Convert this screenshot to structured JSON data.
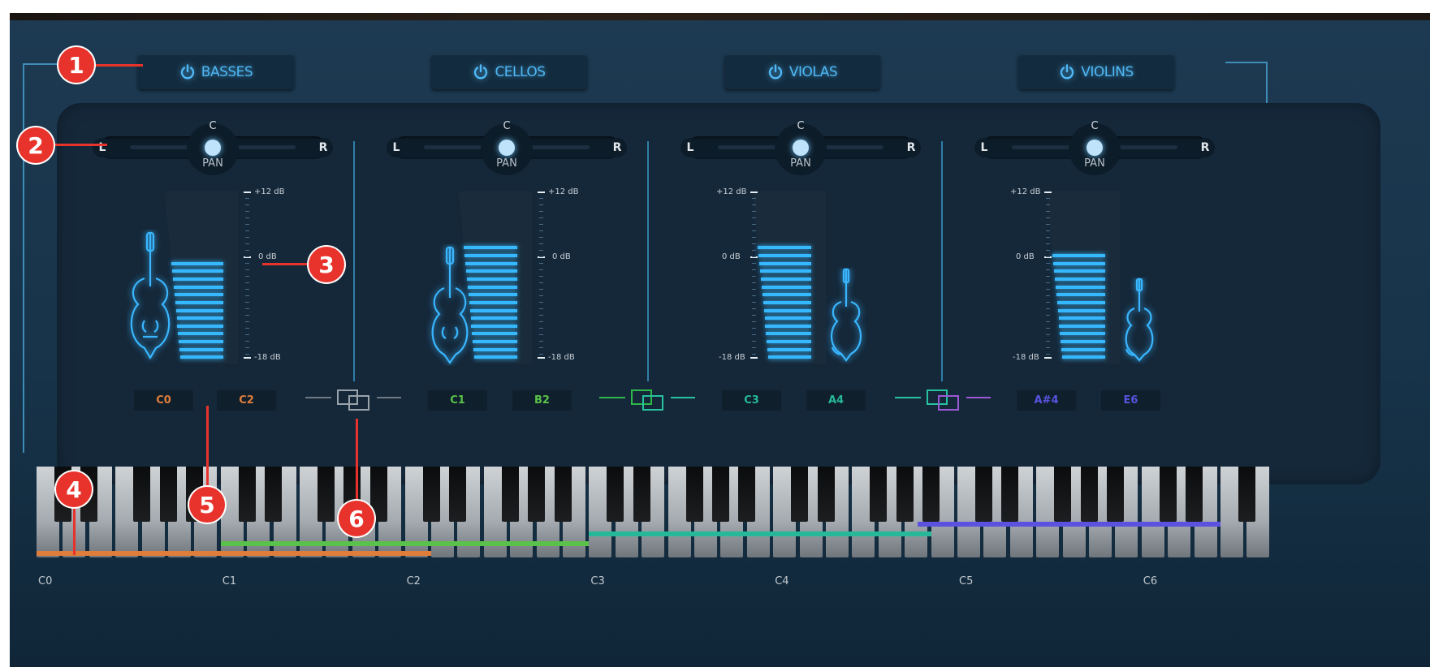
{
  "sections": [
    {
      "name": "BASSES",
      "pan_label": "PAN",
      "pan_center": "C",
      "pan_left": "L",
      "pan_right": "R",
      "meter_top": "+12 dB",
      "meter_mid": "0 dB",
      "meter_bot": "-18 dB",
      "level_fraction": 0.58,
      "range_low": "C0",
      "range_high": "C2",
      "range_color": "#e07d3a",
      "instrument": "double-bass-icon"
    },
    {
      "name": "CELLOS",
      "pan_label": "PAN",
      "pan_center": "C",
      "pan_left": "L",
      "pan_right": "R",
      "meter_top": "+12 dB",
      "meter_mid": "0 dB",
      "meter_bot": "-18 dB",
      "level_fraction": 0.67,
      "range_low": "C1",
      "range_high": "B2",
      "range_color": "#5ac24a",
      "instrument": "cello-icon"
    },
    {
      "name": "VIOLAS",
      "pan_label": "PAN",
      "pan_center": "C",
      "pan_left": "L",
      "pan_right": "R",
      "meter_top": "+12 dB",
      "meter_mid": "0 dB",
      "meter_bot": "-18 dB",
      "level_fraction": 0.67,
      "range_low": "C3",
      "range_high": "A4",
      "range_color": "#27b89a",
      "instrument": "viola-icon"
    },
    {
      "name": "VIOLINS",
      "pan_label": "PAN",
      "pan_center": "C",
      "pan_left": "L",
      "pan_right": "R",
      "meter_top": "+12 dB",
      "meter_mid": "0 dB",
      "meter_bot": "-18 dB",
      "level_fraction": 0.63,
      "range_low": "A#4",
      "range_high": "E6",
      "range_color": "#5b52e0",
      "instrument": "violin-icon"
    }
  ],
  "links": [
    {
      "name": "link-basses-cellos",
      "colors": [
        "#9aa3aa",
        "#9aa3aa"
      ]
    },
    {
      "name": "link-cellos-violas",
      "colors": [
        "#2fb84a",
        "#27c2a0"
      ]
    },
    {
      "name": "link-violas-violins",
      "colors": [
        "#27c2a0",
        "#9b59d6"
      ]
    }
  ],
  "keyboard": {
    "octave_labels": [
      "C0",
      "C1",
      "C2",
      "C3",
      "C4",
      "C5",
      "C6"
    ],
    "ranges": [
      {
        "low": "C0",
        "high": "C2",
        "color": "#e07d3a"
      },
      {
        "low": "C1",
        "high": "B2",
        "color": "#5ac24a"
      },
      {
        "low": "C3",
        "high": "A4",
        "color": "#27b89a"
      },
      {
        "low": "A#4",
        "high": "E6",
        "color": "#5b52e0"
      }
    ]
  },
  "callouts": [
    "1",
    "2",
    "3",
    "4",
    "5",
    "6"
  ],
  "colors": {
    "accent": "#4fb7f4",
    "callout": "#e8332c",
    "meter": "#36b8ff"
  }
}
